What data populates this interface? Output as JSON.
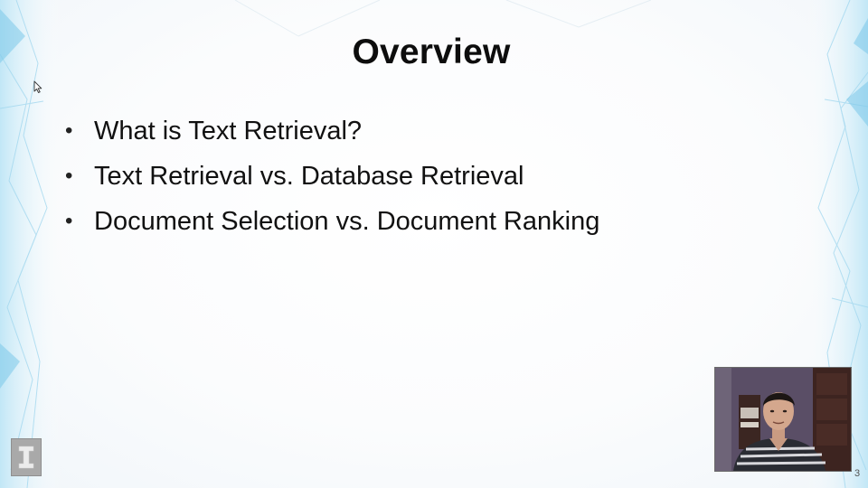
{
  "slide": {
    "title": "Overview",
    "bullets": [
      "What is Text Retrieval?",
      "Text Retrieval vs. Database Retrieval",
      "Document Selection vs. Document Ranking"
    ],
    "bullet_symbol": "•",
    "page_number": "3"
  },
  "logo": {
    "icon": "university-logo-icon"
  },
  "presenter": {
    "icon": "presenter-webcam-video"
  },
  "cursor": {
    "icon": "mouse-pointer-icon"
  },
  "colors": {
    "title": "#0d0d0d",
    "text": "#111111",
    "accent_decor": "#8fd3f0",
    "logo": "#a9a9a9"
  }
}
